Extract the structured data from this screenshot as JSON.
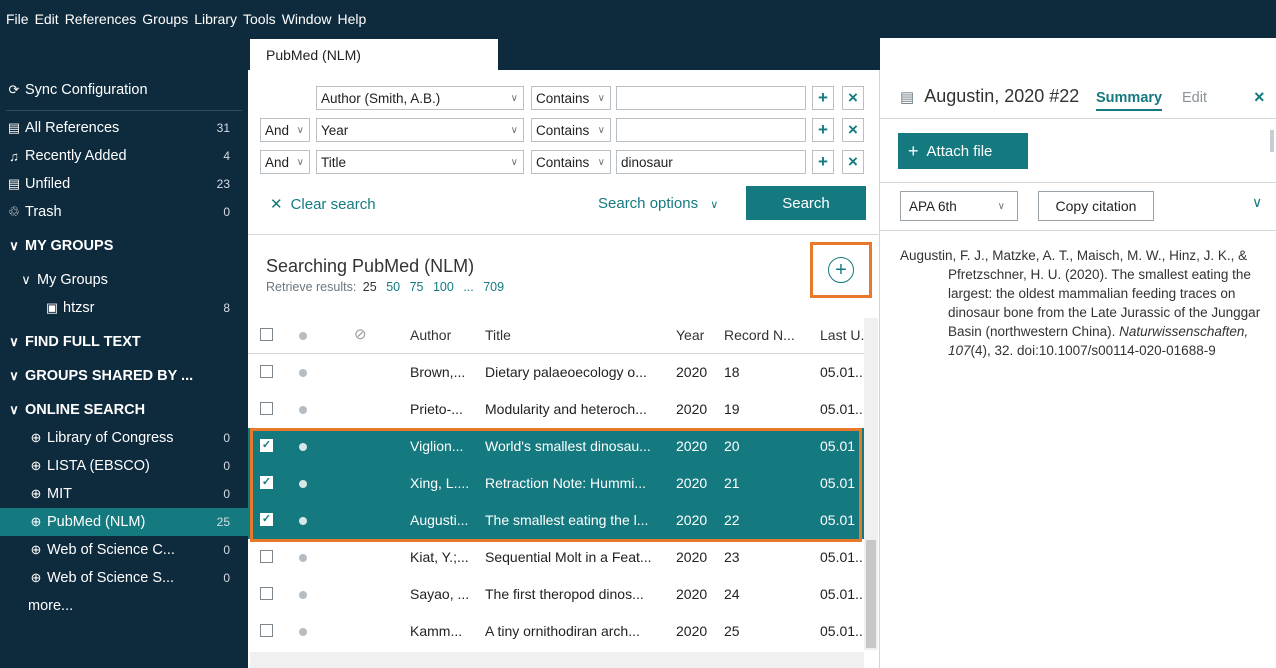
{
  "menu": [
    "File",
    "Edit",
    "References",
    "Groups",
    "Library",
    "Tools",
    "Window",
    "Help"
  ],
  "sidebar": {
    "sync": "Sync Configuration",
    "items": [
      {
        "label": "All References",
        "count": "31",
        "icon": "book-icon"
      },
      {
        "label": "Recently Added",
        "count": "4",
        "icon": "bell-icon"
      },
      {
        "label": "Unfiled",
        "count": "23",
        "icon": "book-icon"
      },
      {
        "label": "Trash",
        "count": "0",
        "icon": "trash-icon"
      }
    ],
    "my_groups_header": "MY GROUPS",
    "my_groups_sub": "My Groups",
    "group": {
      "label": "htzsr",
      "count": "8"
    },
    "find_full_text": "FIND FULL TEXT",
    "groups_shared": "GROUPS SHARED BY ...",
    "online_search": "ONLINE SEARCH",
    "online": [
      {
        "label": "Library of Congress",
        "count": "0"
      },
      {
        "label": "LISTA (EBSCO)",
        "count": "0"
      },
      {
        "label": "MIT",
        "count": "0"
      },
      {
        "label": "PubMed (NLM)",
        "count": "25"
      },
      {
        "label": "Web of Science C...",
        "count": "0"
      },
      {
        "label": "Web of Science S...",
        "count": "0"
      }
    ],
    "more": "more..."
  },
  "tab": "PubMed (NLM)",
  "search": {
    "rows": [
      {
        "bool": "",
        "field": "Author (Smith, A.B.)",
        "op": "Contains",
        "value": ""
      },
      {
        "bool": "And",
        "field": "Year",
        "op": "Contains",
        "value": ""
      },
      {
        "bool": "And",
        "field": "Title",
        "op": "Contains",
        "value": "dinosaur"
      }
    ],
    "clear": "Clear search",
    "options": "Search options",
    "button": "Search"
  },
  "results": {
    "heading": "Searching PubMed (NLM)",
    "retrieve_label": "Retrieve results:",
    "current": "25",
    "options": [
      "50",
      "75",
      "100",
      "...",
      "709"
    ]
  },
  "table": {
    "headers": {
      "author": "Author",
      "title": "Title",
      "year": "Year",
      "record": "Record N...",
      "last": "Last U."
    },
    "rows": [
      {
        "author": "Brown,...",
        "title": "Dietary palaeoecology o...",
        "year": "2020",
        "record": "18",
        "last": "05.01..",
        "selected": false
      },
      {
        "author": "Prieto-...",
        "title": "Modularity and heteroch...",
        "year": "2020",
        "record": "19",
        "last": "05.01..",
        "selected": false
      },
      {
        "author": "Viglion...",
        "title": "World's smallest dinosau...",
        "year": "2020",
        "record": "20",
        "last": "05.01",
        "selected": true
      },
      {
        "author": "Xing, L....",
        "title": "Retraction Note: Hummi...",
        "year": "2020",
        "record": "21",
        "last": "05.01",
        "selected": true
      },
      {
        "author": "Augusti...",
        "title": "The smallest eating the l...",
        "year": "2020",
        "record": "22",
        "last": "05.01",
        "selected": true
      },
      {
        "author": "Kiat, Y.;...",
        "title": "Sequential Molt in a Feat...",
        "year": "2020",
        "record": "23",
        "last": "05.01..",
        "selected": false
      },
      {
        "author": "Sayao, ...",
        "title": "The first theropod dinos...",
        "year": "2020",
        "record": "24",
        "last": "05.01..",
        "selected": false
      },
      {
        "author": "Kamm...",
        "title": "A tiny ornithodiran arch...",
        "year": "2020",
        "record": "25",
        "last": "05.01..",
        "selected": false
      }
    ]
  },
  "panel": {
    "title": "Augustin, 2020 #22",
    "tab_summary": "Summary",
    "tab_edit": "Edit",
    "attach": "Attach file",
    "style": "APA 6th",
    "copy": "Copy citation",
    "citation_main": "Augustin, F. J., Matzke, A. T., Maisch, M. W., Hinz, J. K., & Pfretzschner, H. U. (2020). The smallest eating the largest: the oldest mammalian feeding traces on dinosaur bone from the Late Jurassic of the Junggar Basin (northwestern China).",
    "citation_journal": "Naturwissenschaften, 107",
    "citation_tail": "(4), 32. doi:10.1007/s00114-020-01688-9"
  },
  "colors": {
    "accent": "#157a80",
    "nav": "#0e2a3d",
    "highlight": "#e8782a"
  }
}
